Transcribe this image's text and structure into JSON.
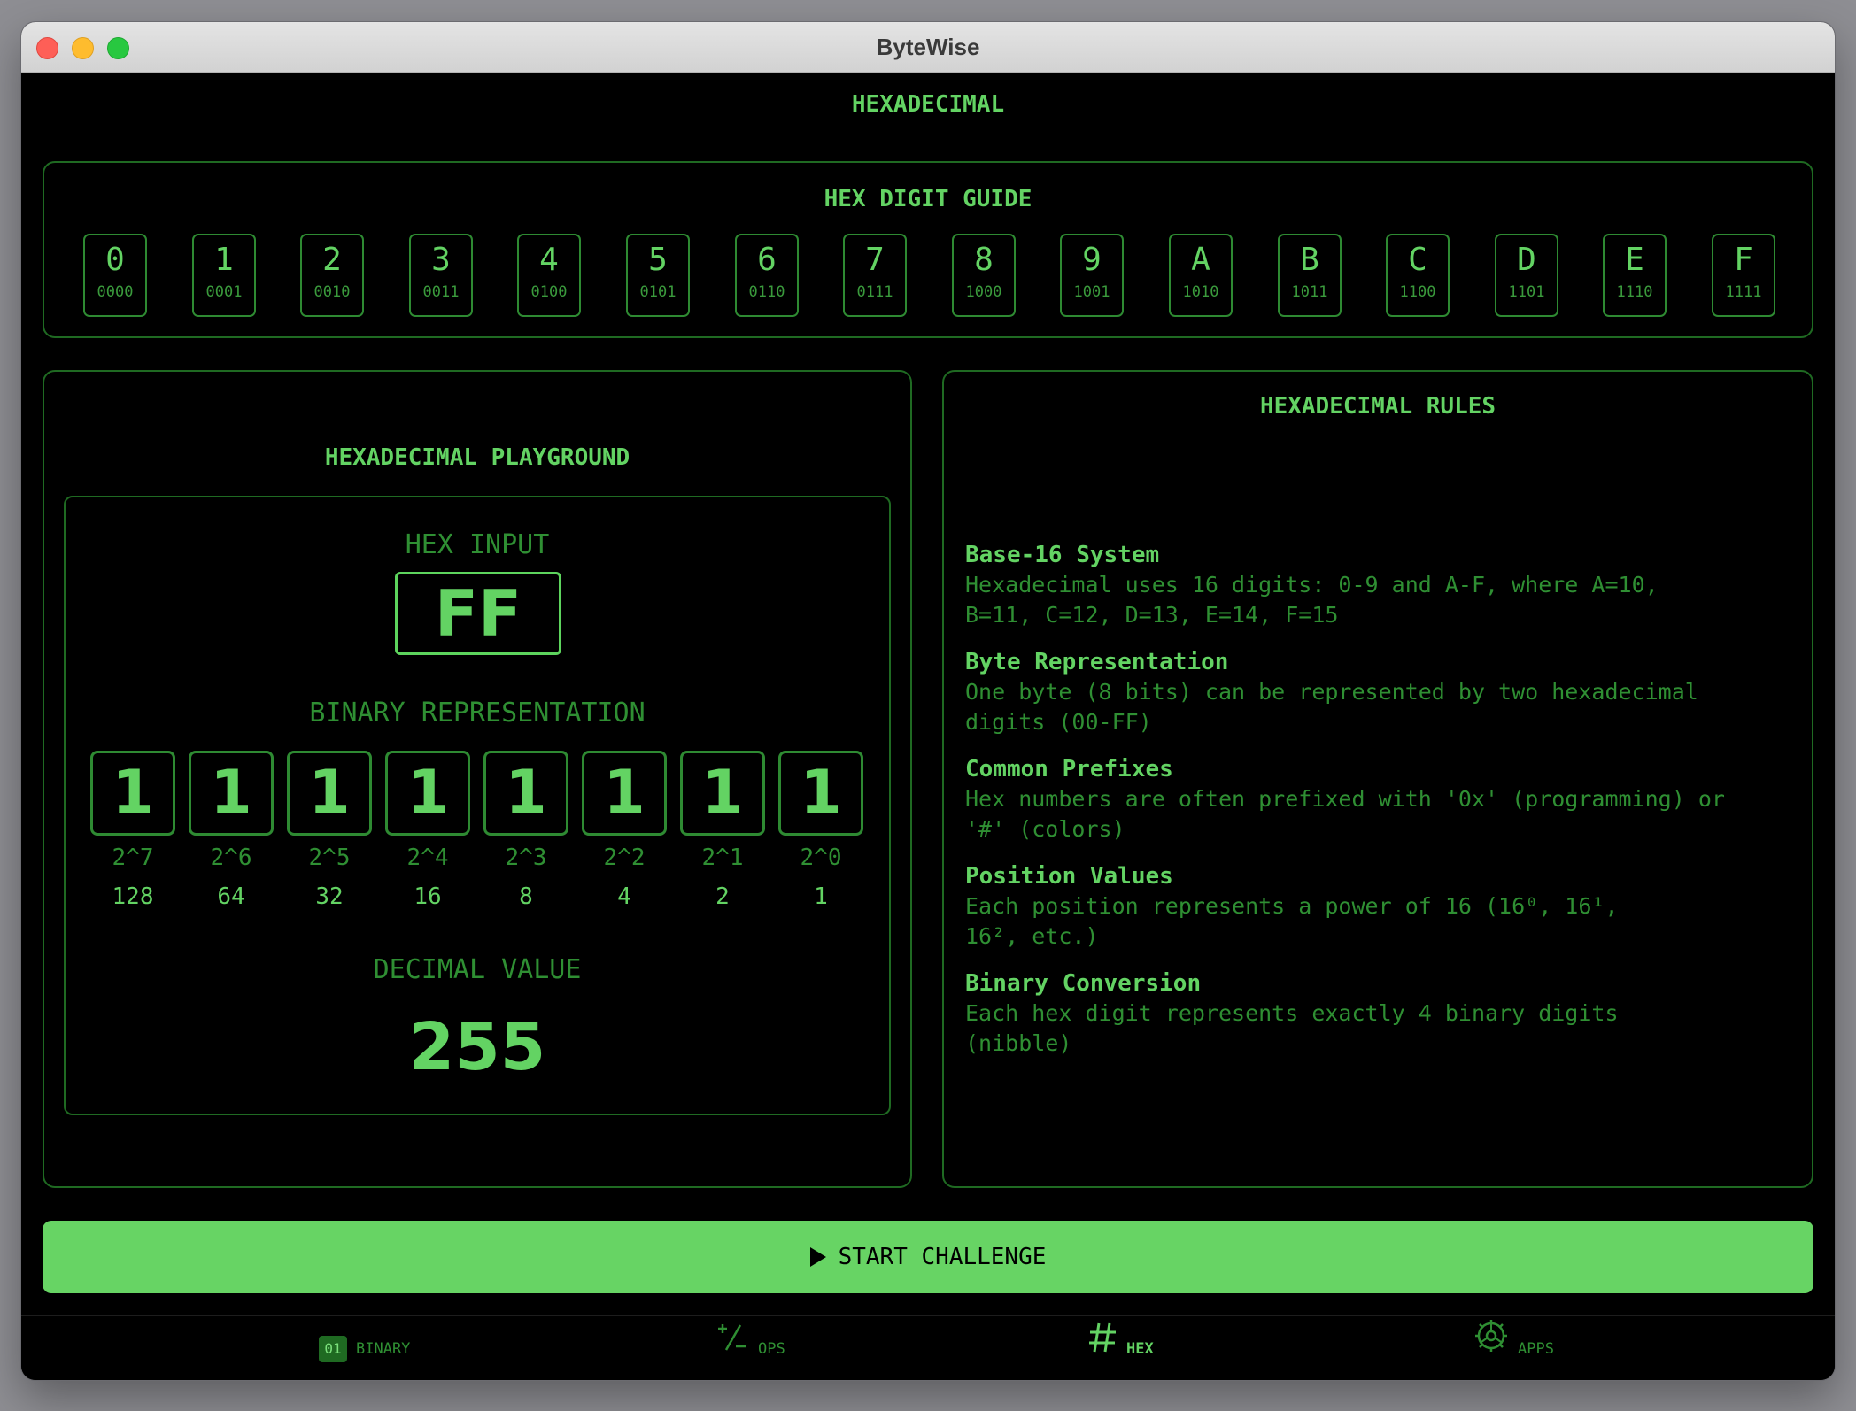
{
  "window": {
    "title": "ByteWise"
  },
  "header": {
    "title": "HEXADECIMAL"
  },
  "guide": {
    "title": "HEX DIGIT GUIDE",
    "digits": [
      {
        "hex": "0",
        "bin": "0000"
      },
      {
        "hex": "1",
        "bin": "0001"
      },
      {
        "hex": "2",
        "bin": "0010"
      },
      {
        "hex": "3",
        "bin": "0011"
      },
      {
        "hex": "4",
        "bin": "0100"
      },
      {
        "hex": "5",
        "bin": "0101"
      },
      {
        "hex": "6",
        "bin": "0110"
      },
      {
        "hex": "7",
        "bin": "0111"
      },
      {
        "hex": "8",
        "bin": "1000"
      },
      {
        "hex": "9",
        "bin": "1001"
      },
      {
        "hex": "A",
        "bin": "1010"
      },
      {
        "hex": "B",
        "bin": "1011"
      },
      {
        "hex": "C",
        "bin": "1100"
      },
      {
        "hex": "D",
        "bin": "1101"
      },
      {
        "hex": "E",
        "bin": "1110"
      },
      {
        "hex": "F",
        "bin": "1111"
      }
    ]
  },
  "playground": {
    "title": "HEXADECIMAL PLAYGROUND",
    "hex_input_label": "HEX INPUT",
    "hex_input_value": "FF",
    "binary_label": "BINARY REPRESENTATION",
    "bits": [
      {
        "bit": "1",
        "power": "2^7",
        "value": "128"
      },
      {
        "bit": "1",
        "power": "2^6",
        "value": "64"
      },
      {
        "bit": "1",
        "power": "2^5",
        "value": "32"
      },
      {
        "bit": "1",
        "power": "2^4",
        "value": "16"
      },
      {
        "bit": "1",
        "power": "2^3",
        "value": "8"
      },
      {
        "bit": "1",
        "power": "2^2",
        "value": "4"
      },
      {
        "bit": "1",
        "power": "2^1",
        "value": "2"
      },
      {
        "bit": "1",
        "power": "2^0",
        "value": "1"
      }
    ],
    "decimal_label": "DECIMAL VALUE",
    "decimal_value": "255"
  },
  "rules": {
    "title": "HEXADECIMAL RULES",
    "items": [
      {
        "heading": "Base-16 System",
        "line1": "Hexadecimal uses 16 digits: 0-9 and A-F, where A=10,",
        "line2": "B=11, C=12, D=13, E=14, F=15"
      },
      {
        "heading": "Byte Representation",
        "line1": "One byte (8 bits) can be represented by two hexadecimal",
        "line2": "digits (00-FF)"
      },
      {
        "heading": "Common Prefixes",
        "line1": "Hex numbers are often prefixed with '0x' (programming) or",
        "line2": "'#' (colors)"
      },
      {
        "heading": "Position Values",
        "line1": "Each position represents a power of 16 (16⁰, 16¹,",
        "line2": "16², etc.)"
      },
      {
        "heading": "Binary Conversion",
        "line1": "Each hex digit represents exactly 4 binary digits",
        "line2": "(nibble)"
      }
    ]
  },
  "start_button": {
    "label": "START CHALLENGE"
  },
  "tabs": [
    {
      "label": "BINARY",
      "icon": "binary-icon",
      "icon_text": "01",
      "active": false
    },
    {
      "label": "OPS",
      "icon": "plus-minus-icon",
      "active": false
    },
    {
      "label": "HEX",
      "icon": "hash-icon",
      "active": true
    },
    {
      "label": "APPS",
      "icon": "gear-icon",
      "active": false
    }
  ],
  "colors": {
    "accent": "#63d363",
    "dim": "#2f8f33",
    "border": "#1f6a22",
    "button": "#67d464",
    "background": "#000000"
  }
}
